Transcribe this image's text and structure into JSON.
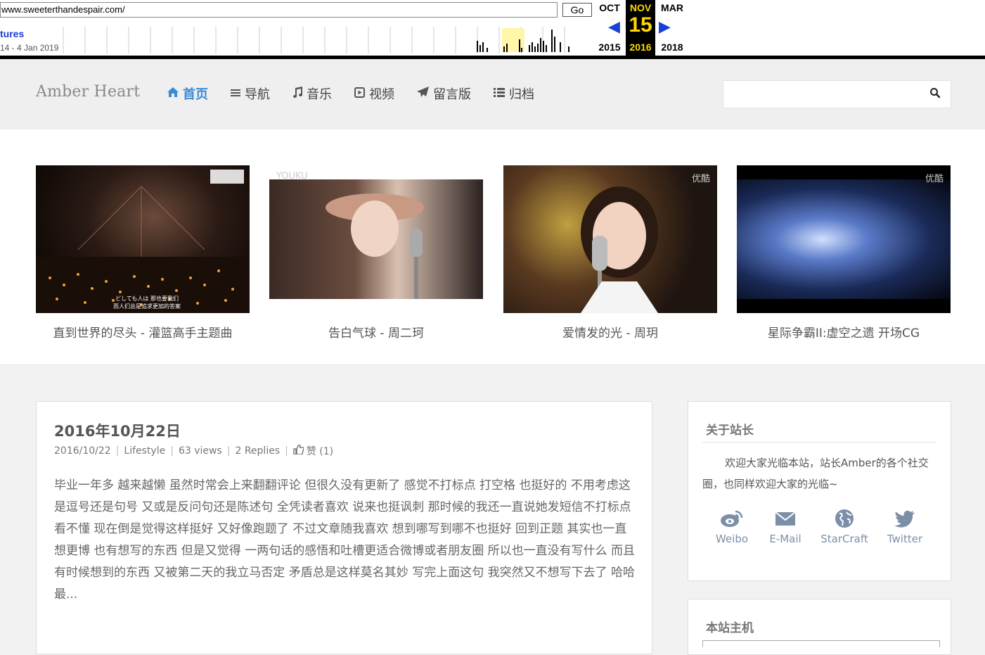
{
  "wayback": {
    "url": "www.sweeterthandespair.com/",
    "go_label": "Go",
    "captures_label": "tures",
    "range": "14 - 4 Jan 2019",
    "prev_month": "OCT",
    "cur_month": "NOV",
    "next_month": "MAR",
    "cur_day": "15",
    "prev_year": "2015",
    "cur_year": "2016",
    "next_year": "2018"
  },
  "header": {
    "logo": "Amber Heart",
    "nav": [
      {
        "label": "首页",
        "icon": "home-icon"
      },
      {
        "label": "导航",
        "icon": "menu-icon"
      },
      {
        "label": "音乐",
        "icon": "music-icon"
      },
      {
        "label": "视频",
        "icon": "play-icon"
      },
      {
        "label": "留言版",
        "icon": "send-icon"
      },
      {
        "label": "归档",
        "icon": "list-icon"
      }
    ],
    "search_placeholder": ""
  },
  "featured": [
    {
      "title": "直到世界的尽头 - 灌篮高手主题曲",
      "caption1": "どしても人は 那也要我们",
      "caption2": "而人们总是追求更加的答案"
    },
    {
      "title": "告白气球 - 周二珂",
      "watermark": "YOUKU"
    },
    {
      "title": "爱情发的光 - 周玥",
      "watermark": "优酷"
    },
    {
      "title": "星际争霸II:虚空之遗 开场CG",
      "watermark": "优酷"
    }
  ],
  "post": {
    "title": "2016年10月22日",
    "date": "2016/10/22",
    "category": "Lifestyle",
    "views": "63 views",
    "replies": "2 Replies",
    "likes": "赞 (1)",
    "excerpt": "毕业一年多 越来越懒 虽然时常会上来翻翻评论 但很久没有更新了 感觉不打标点 打空格 也挺好的 不用考虑这是逗号还是句号 又或是反问句还是陈述句 全凭读者喜欢 说来也挺讽刺 那时候的我还一直说她发短信不打标点 看不懂 现在倒是觉得这样挺好 又好像跑题了 不过文章随我喜欢 想到哪写到哪不也挺好 回到正题 其实也一直想更博 也有想写的东西 但是又觉得 一两句话的感悟和吐槽更适合微博或者朋友圈 所以也一直没有写什么 而且有时候想到的东西 又被第二天的我立马否定 矛盾总是这样莫名其妙 写完上面这句 我突然又不想写下去了 哈哈 最..."
  },
  "about": {
    "title": "关于站长",
    "text": "欢迎大家光临本站，站长Amber的各个社交圈，也同样欢迎大家的光临~",
    "socials": [
      {
        "label": "Weibo",
        "icon": "weibo-icon"
      },
      {
        "label": "E-Mail",
        "icon": "mail-icon"
      },
      {
        "label": "StarCraft",
        "icon": "globe-icon"
      },
      {
        "label": "Twitter",
        "icon": "twitter-icon"
      }
    ]
  },
  "host": {
    "title": "本站主机"
  },
  "colors": {
    "accent": "#3a8ad4",
    "social": "#7b8fa8",
    "wayback_blue": "#1a3fd6",
    "wayback_gold": "#ffd700"
  }
}
